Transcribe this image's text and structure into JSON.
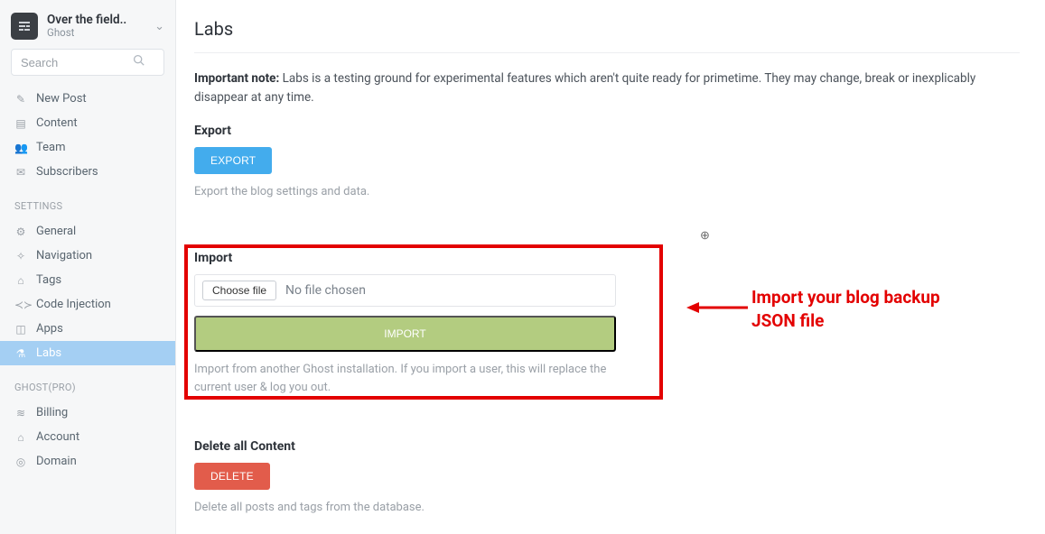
{
  "site": {
    "title": "Over the field..",
    "subtitle": "Ghost"
  },
  "search": {
    "placeholder": "Search"
  },
  "nav": {
    "main": [
      {
        "label": "New Post"
      },
      {
        "label": "Content"
      },
      {
        "label": "Team"
      },
      {
        "label": "Subscribers"
      }
    ],
    "settings_heading": "SETTINGS",
    "settings": [
      {
        "label": "General"
      },
      {
        "label": "Navigation"
      },
      {
        "label": "Tags"
      },
      {
        "label": "Code Injection"
      },
      {
        "label": "Apps"
      },
      {
        "label": "Labs"
      }
    ],
    "pro_heading": "GHOST(PRO)",
    "pro": [
      {
        "label": "Billing"
      },
      {
        "label": "Account"
      },
      {
        "label": "Domain"
      }
    ]
  },
  "page": {
    "title": "Labs",
    "note_label": "Important note:",
    "note_text": "Labs is a testing ground for experimental features which aren't quite ready for primetime. They may change, break or inexplicably disappear at any time.",
    "export": {
      "title": "Export",
      "button": "EXPORT",
      "hint": "Export the blog settings and data."
    },
    "import": {
      "title": "Import",
      "choose_label": "Choose file",
      "file_status": "No file chosen",
      "button": "IMPORT",
      "hint": "Import from another Ghost installation. If you import a user, this will replace the current user & log you out."
    },
    "delete": {
      "title": "Delete all Content",
      "button": "DELETE",
      "hint": "Delete all posts and tags from the database."
    }
  },
  "annotation": {
    "text": "Import your blog backup JSON file"
  }
}
